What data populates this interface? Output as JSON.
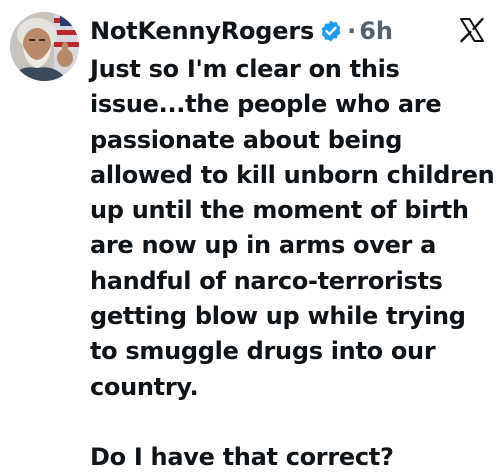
{
  "tweet": {
    "author_name": "NotKennyRogers",
    "verified_icon": "verified-badge-icon",
    "separator": "·",
    "time": "6h",
    "platform_icon": "x-logo-icon",
    "text": "Just so I'm clear on this issue...the people who are passionate about being allowed to kill unborn children up until the moment of birth are now up in arms over a handful of narco-terrorists getting blow up while trying to smuggle drugs into our country.\n\nDo I have that correct?"
  },
  "colors": {
    "verified_blue": "#1d9bf0",
    "muted_gray": "#536471",
    "text": "#0f1419"
  }
}
